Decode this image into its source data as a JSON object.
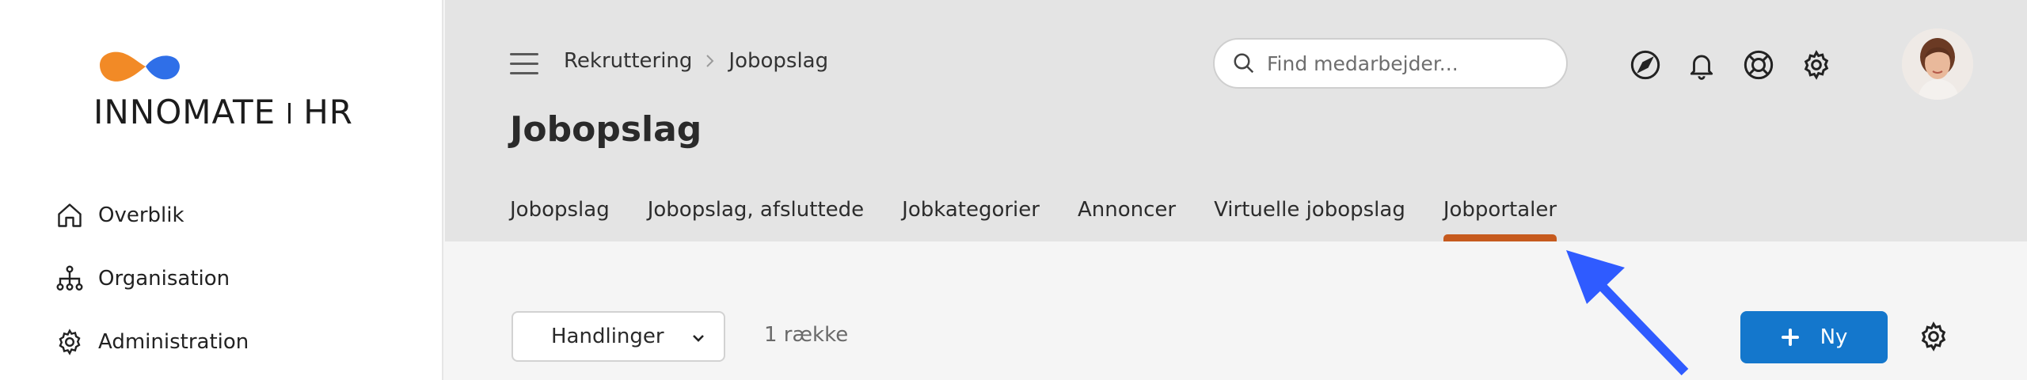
{
  "logo": {
    "brand_left": "INNOMATE",
    "brand_right": "HR",
    "colors": {
      "orange": "#F28A26",
      "blue": "#2F6FE8"
    }
  },
  "sidebar": {
    "items": [
      {
        "label": "Overblik",
        "icon": "home-icon"
      },
      {
        "label": "Organisation",
        "icon": "org-chart-icon"
      },
      {
        "label": "Administration",
        "icon": "gear-icon"
      }
    ]
  },
  "header": {
    "breadcrumb": [
      "Rekruttering",
      "Jobopslag"
    ],
    "title": "Jobopslag",
    "search": {
      "placeholder": "Find medarbejder...",
      "value": ""
    },
    "icons": [
      "navigation-icon",
      "bell-icon",
      "lifebuoy-icon",
      "settings-icon"
    ]
  },
  "tabs": [
    {
      "label": "Jobopslag",
      "active": false
    },
    {
      "label": "Jobopslag, afsluttede",
      "active": false
    },
    {
      "label": "Jobkategorier",
      "active": false
    },
    {
      "label": "Annoncer",
      "active": false
    },
    {
      "label": "Virtuelle jobopslag",
      "active": false
    },
    {
      "label": "Jobportaler",
      "active": true
    }
  ],
  "toolbar": {
    "actions_label": "Handlinger",
    "row_count": "1 række",
    "new_label": "Ny"
  },
  "colors": {
    "accent_tab": "#C65A1E",
    "primary_button": "#1477CC",
    "annotation_arrow": "#2F5BFF"
  }
}
